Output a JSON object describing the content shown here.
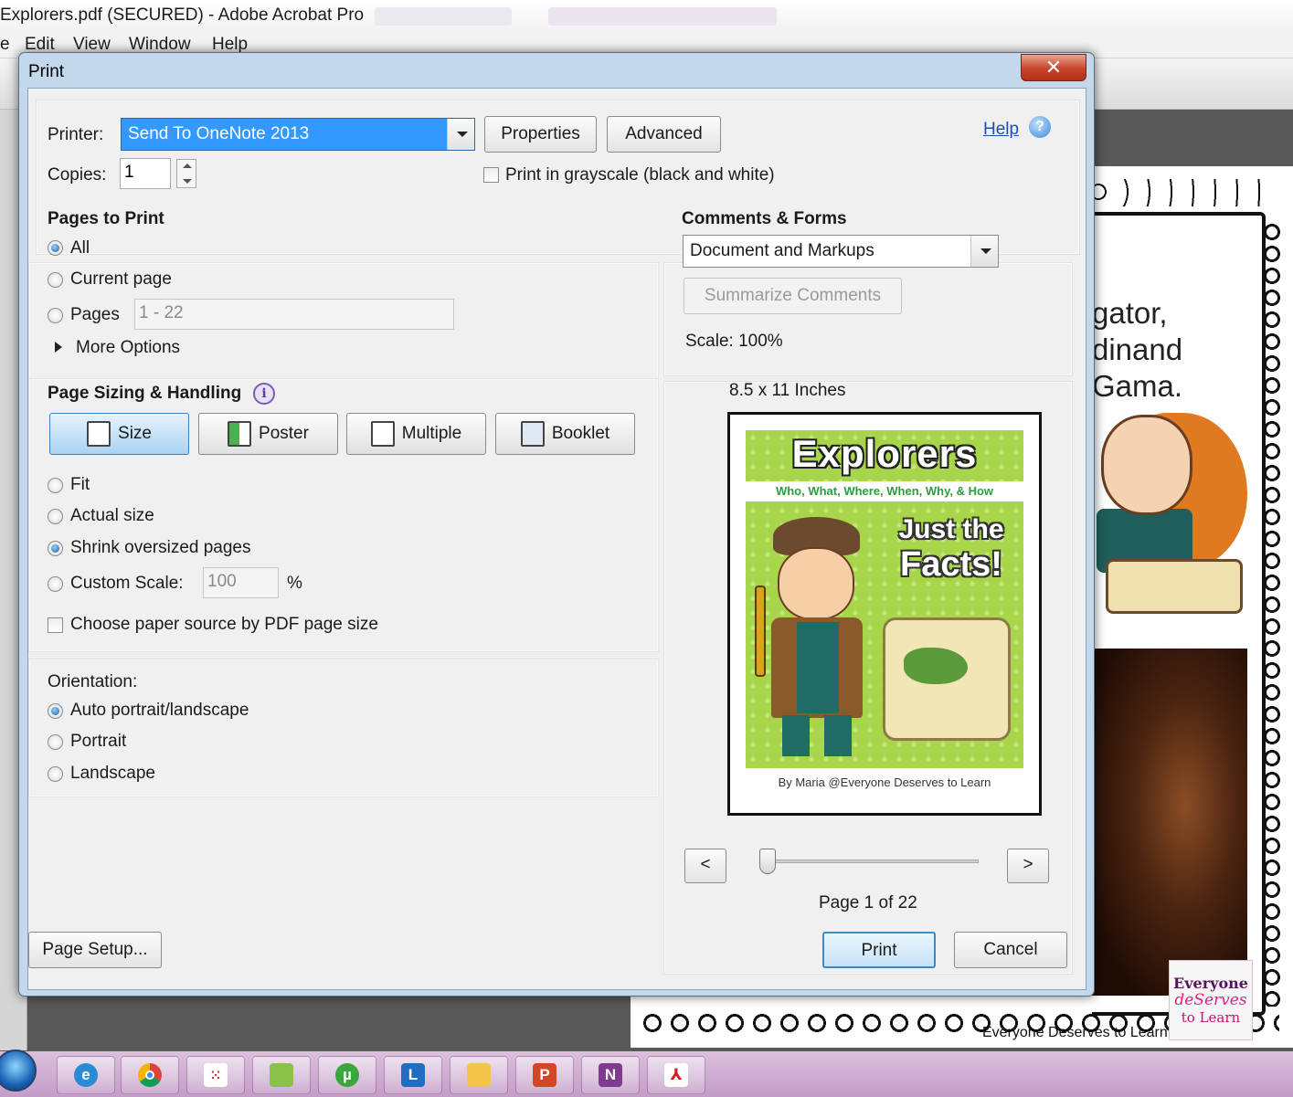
{
  "app": {
    "title": "Explorers.pdf (SECURED) - Adobe Acrobat Pro",
    "menu": [
      "e",
      "Edit",
      "View",
      "Window",
      "Help"
    ]
  },
  "document": {
    "lines": [
      "gator,",
      "dinand",
      "Gama."
    ],
    "footer": "Everyone Deserves to Learn"
  },
  "brand_logo": [
    "Everyone",
    "deServes",
    "to Learn"
  ],
  "dialog": {
    "title": "Print",
    "close": "✕",
    "printer_label": "Printer:",
    "printer_value": "Send To OneNote 2013",
    "properties": "Properties",
    "advanced": "Advanced",
    "help": "Help",
    "copies_label": "Copies:",
    "copies_value": "1",
    "grayscale": "Print in grayscale (black and white)",
    "pages_to_print": {
      "heading": "Pages to Print",
      "all": "All",
      "current": "Current page",
      "pages": "Pages",
      "pages_range": "1 - 22",
      "more_options": "More Options"
    },
    "sizing": {
      "heading": "Page Sizing & Handling",
      "tabs": [
        "Size",
        "Poster",
        "Multiple",
        "Booklet"
      ],
      "fit": "Fit",
      "actual": "Actual size",
      "shrink": "Shrink oversized pages",
      "custom": "Custom Scale:",
      "custom_value": "100",
      "percent": "%",
      "paper_source": "Choose paper source by PDF page size"
    },
    "orientation": {
      "heading": "Orientation:",
      "auto": "Auto portrait/landscape",
      "portrait": "Portrait",
      "landscape": "Landscape"
    },
    "comments": {
      "heading": "Comments & Forms",
      "value": "Document and Markups",
      "summarize": "Summarize Comments"
    },
    "preview": {
      "scale": "Scale: 100%",
      "paper": "8.5 x 11 Inches",
      "cover_title": "Explorers",
      "cover_subtitle": "Who, What, Where, When, Why, & How",
      "cover_tag1": "Just the",
      "cover_tag2": "Facts!",
      "cover_byline": "By Maria @Everyone Deserves to Learn",
      "prev": "<",
      "next": ">",
      "page_info": "Page 1 of 22"
    },
    "page_setup": "Page Setup...",
    "print": "Print",
    "cancel": "Cancel"
  },
  "colors": {
    "dialog_frame": "#c4d8ec",
    "selection": "#3399ff",
    "cover_green": "#a8d64a",
    "taskbar": "#c49cc8"
  },
  "taskbar_icons": [
    "ie-icon",
    "chrome-icon",
    "apps-icon",
    "folders-icon",
    "utorrent-icon",
    "lync-icon",
    "network-icon",
    "powerpoint-icon",
    "onenote-icon",
    "acrobat-icon"
  ]
}
